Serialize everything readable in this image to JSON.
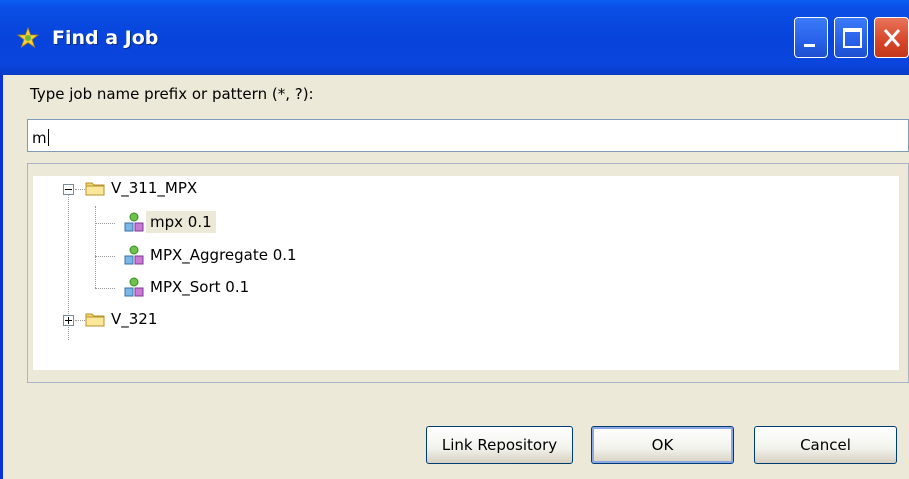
{
  "window": {
    "title": "Find a Job",
    "icon": "star-gear-icon"
  },
  "prompt_label": "Type job name prefix or pattern (*, ?):",
  "search": {
    "value": "m"
  },
  "tree": {
    "folders": [
      {
        "label": "V_311_MPX",
        "expanded": true,
        "items": [
          {
            "label": "mpx 0.1",
            "selected": true
          },
          {
            "label": "MPX_Aggregate 0.1",
            "selected": false
          },
          {
            "label": "MPX_Sort 0.1",
            "selected": false
          }
        ]
      },
      {
        "label": "V_321",
        "expanded": false,
        "items": []
      }
    ]
  },
  "buttons": {
    "link_repository": "Link Repository",
    "ok": "OK",
    "cancel": "Cancel"
  },
  "colors": {
    "titlebar": "#0a4fe6",
    "dialog_bg": "#ece9d8",
    "close_button": "#d8452a"
  }
}
